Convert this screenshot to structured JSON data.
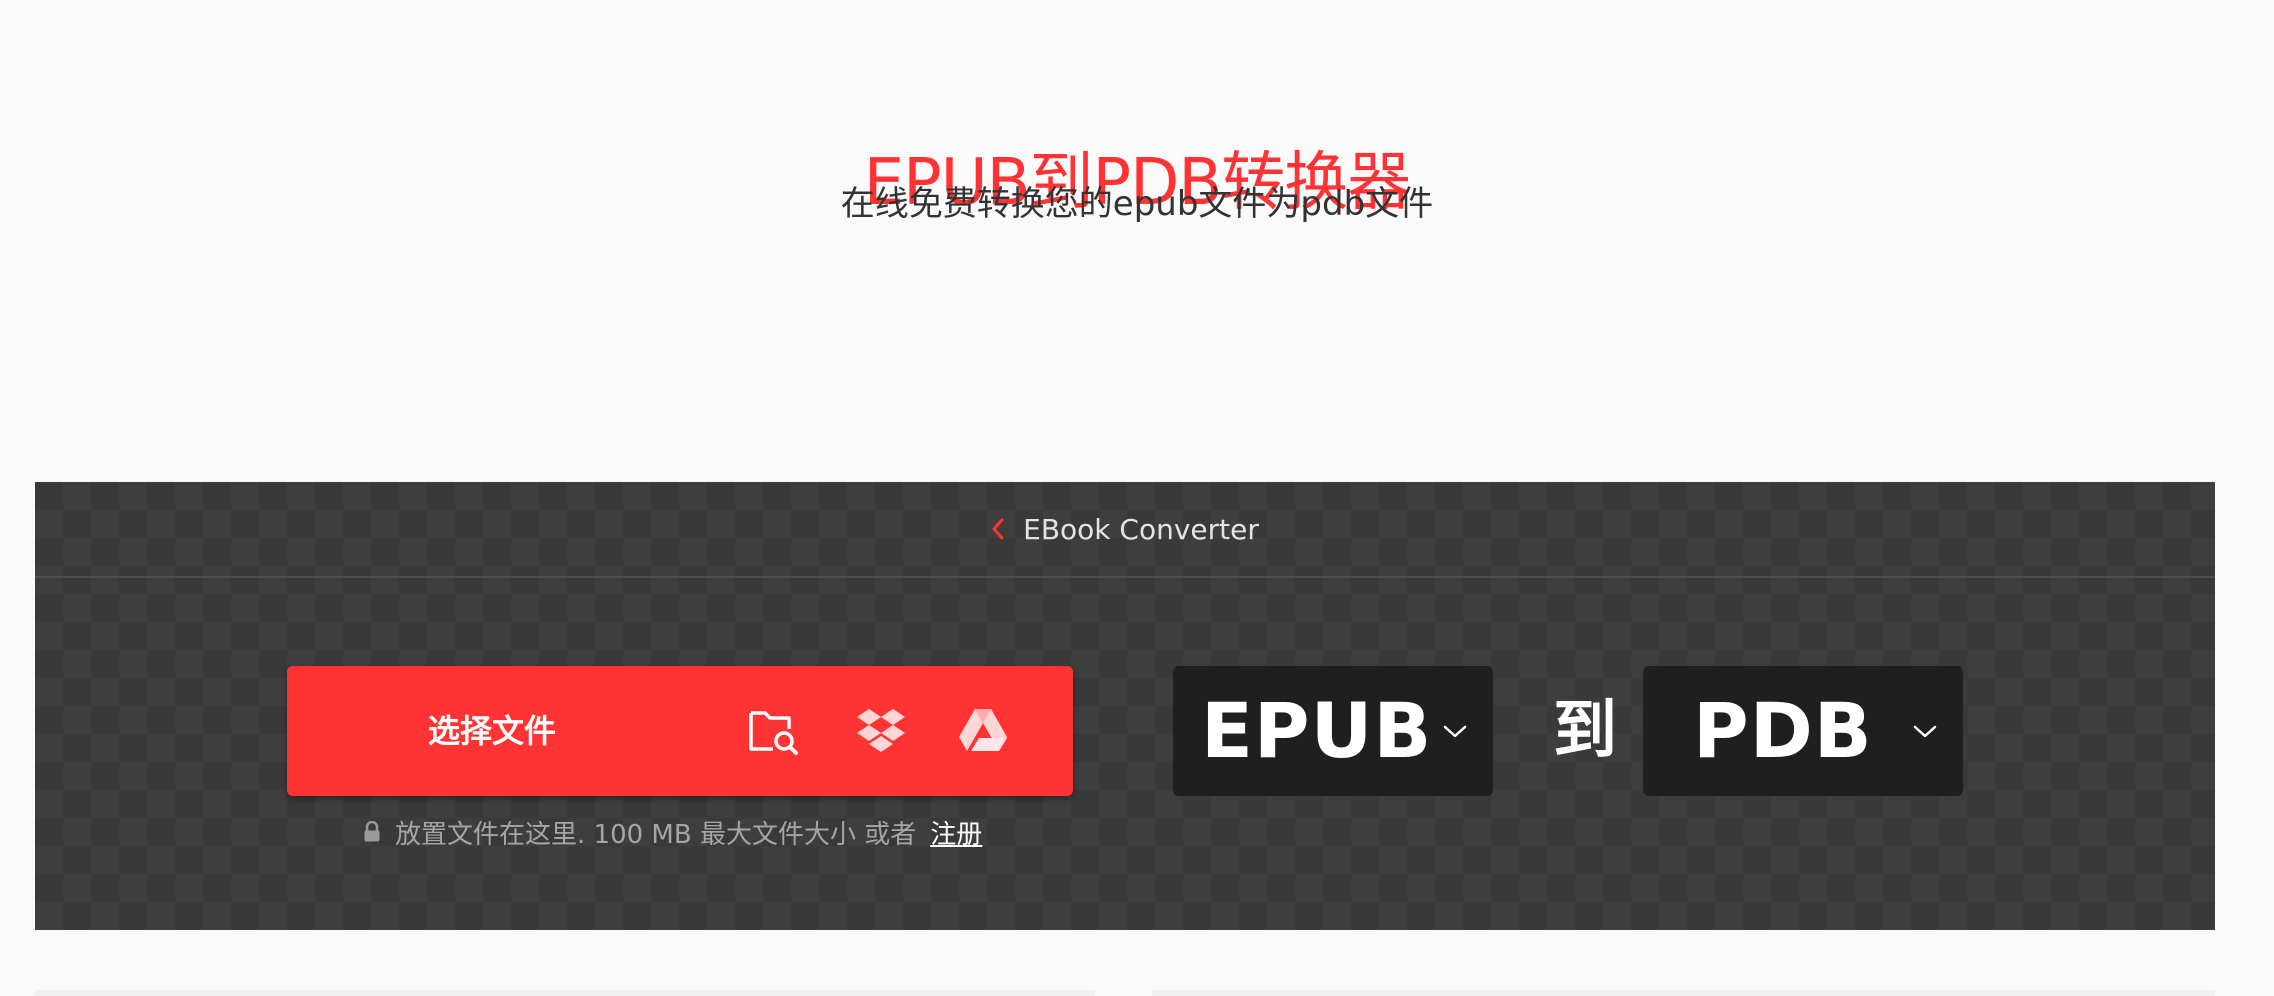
{
  "hero": {
    "title": "EPUB到PDB转换器",
    "subtitle": "在线免费转换您的epub文件为pdb文件"
  },
  "converter": {
    "breadcrumb": {
      "icon": "chevron-left-icon",
      "label": "EBook Converter"
    },
    "upload": {
      "button_label": "选择文件",
      "sources": [
        {
          "icon": "folder-search-icon",
          "name": "browse"
        },
        {
          "icon": "dropbox-icon",
          "name": "dropbox"
        },
        {
          "icon": "google-drive-icon",
          "name": "google-drive"
        }
      ],
      "hint_text": "放置文件在这里. 100 MB 最大文件大小 或者",
      "signup_link": "注册"
    },
    "from_format": "EPUB",
    "to_label": "到",
    "to_format": "PDB"
  },
  "colors": {
    "brand": "#ff3333",
    "panel": "#393939",
    "select_bg": "#1f1f1f",
    "page_bg": "#fafafb"
  }
}
